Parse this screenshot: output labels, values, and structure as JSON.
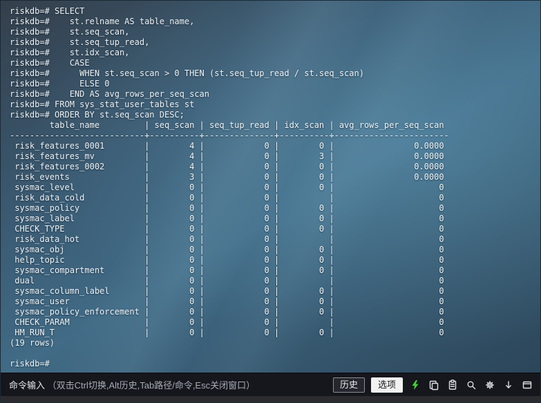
{
  "colors": {
    "terminal_text": "#eef3f6",
    "lightning": "#3fd435",
    "statusbar_bg": "#16161d",
    "option_button_bg": "#f2f2f2"
  },
  "terminal": {
    "prompt": "riskdb=#",
    "query_lines": [
      "riskdb=# SELECT",
      "riskdb=#    st.relname AS table_name,",
      "riskdb=#    st.seq_scan,",
      "riskdb=#    st.seq_tup_read,",
      "riskdb=#    st.idx_scan,",
      "riskdb=#    CASE",
      "riskdb=#      WHEN st.seq_scan > 0 THEN (st.seq_tup_read / st.seq_scan)",
      "riskdb=#      ELSE 0",
      "riskdb=#    END AS avg_rows_per_seq_scan",
      "riskdb=# FROM sys_stat_user_tables st",
      "riskdb=# ORDER BY st.seq_scan DESC;"
    ],
    "result_table": {
      "columns": [
        "table_name",
        "seq_scan",
        "seq_tup_read",
        "idx_scan",
        "avg_rows_per_seq_scan"
      ],
      "rows": [
        [
          "risk_features_0001",
          4,
          0,
          0,
          "0.0000"
        ],
        [
          "risk_features_mv",
          4,
          0,
          3,
          "0.0000"
        ],
        [
          "risk_features_0002",
          4,
          0,
          0,
          "0.0000"
        ],
        [
          "risk_events",
          3,
          0,
          0,
          "0.0000"
        ],
        [
          "sysmac_level",
          0,
          0,
          0,
          "0"
        ],
        [
          "risk_data_cold",
          0,
          0,
          null,
          "0"
        ],
        [
          "sysmac_policy",
          0,
          0,
          0,
          "0"
        ],
        [
          "sysmac_label",
          0,
          0,
          0,
          "0"
        ],
        [
          "CHECK_TYPE",
          0,
          0,
          0,
          "0"
        ],
        [
          "risk_data_hot",
          0,
          0,
          null,
          "0"
        ],
        [
          "sysmac_obj",
          0,
          0,
          0,
          "0"
        ],
        [
          "help_topic",
          0,
          0,
          0,
          "0"
        ],
        [
          "sysmac_compartment",
          0,
          0,
          0,
          "0"
        ],
        [
          "dual",
          0,
          0,
          null,
          "0"
        ],
        [
          "sysmac_column_label",
          0,
          0,
          0,
          "0"
        ],
        [
          "sysmac_user",
          0,
          0,
          0,
          "0"
        ],
        [
          "sysmac_policy_enforcement",
          0,
          0,
          0,
          "0"
        ],
        [
          "CHECK_PARAM",
          0,
          0,
          null,
          "0"
        ],
        [
          "HM_RUN_T",
          0,
          0,
          0,
          "0"
        ]
      ],
      "row_count_label": "(19 rows)"
    },
    "trailing_prompt": "riskdb=#"
  },
  "status_bar": {
    "input_label": "命令输入",
    "input_hint": "（双击Ctrl切换,Alt历史,Tab路径/命令,Esc关闭窗口）",
    "history_button": "历史",
    "options_button": "选项",
    "icons": [
      {
        "name": "lightning-icon"
      },
      {
        "name": "copy-icon"
      },
      {
        "name": "paste-icon"
      },
      {
        "name": "search-icon"
      },
      {
        "name": "gear-icon"
      },
      {
        "name": "download-icon"
      },
      {
        "name": "window-icon"
      }
    ]
  }
}
